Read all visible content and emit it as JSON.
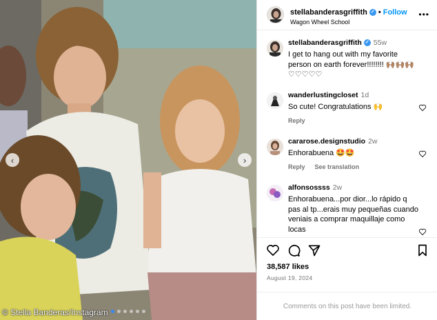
{
  "post": {
    "username": "stellabanderasgriffith",
    "verified_mark": "✓",
    "separator": "•",
    "follow_label": "Follow",
    "location": "Wagon Wheel School",
    "more_icon": "•••"
  },
  "photo": {
    "credit": "© Stella Banderas/Instagram",
    "prev_icon": "‹",
    "next_icon": "›",
    "dots_count": 6,
    "active_dot": 0
  },
  "caption": {
    "username": "stellabanderasgriffith",
    "time": "55w",
    "text": "I get to hang out with my favorite person on earth forever!!!!!!!! 🙌🏽🙌🏽🙌🏽 ♡♡♡♡♡"
  },
  "comments": [
    {
      "username": "wanderlustingcloset",
      "time": "1d",
      "text": "So cute! Congratulations 🙌",
      "actions": [
        "Reply"
      ]
    },
    {
      "username": "cararose.designstudio",
      "time": "2w",
      "text": "Enhorabuena 🤩🤩",
      "actions": [
        "Reply",
        "See translation"
      ]
    },
    {
      "username": "alfonsossss",
      "time": "2w",
      "text": "Enhorabuena...por dior...lo rápido q pas al tp...erais muy pequeñas cuando veniais a comprar maquillaje como locas",
      "actions": []
    }
  ],
  "footer": {
    "likes": "38,587 likes",
    "date": "August 19, 2024",
    "comments_limited": "Comments on this post have been limited."
  },
  "icons": {
    "like": "heart-icon",
    "comment": "comment-icon",
    "share": "share-icon",
    "save": "bookmark-icon"
  },
  "colors": {
    "accent": "#0095f6",
    "verified": "#3897f0",
    "muted": "#737373"
  }
}
